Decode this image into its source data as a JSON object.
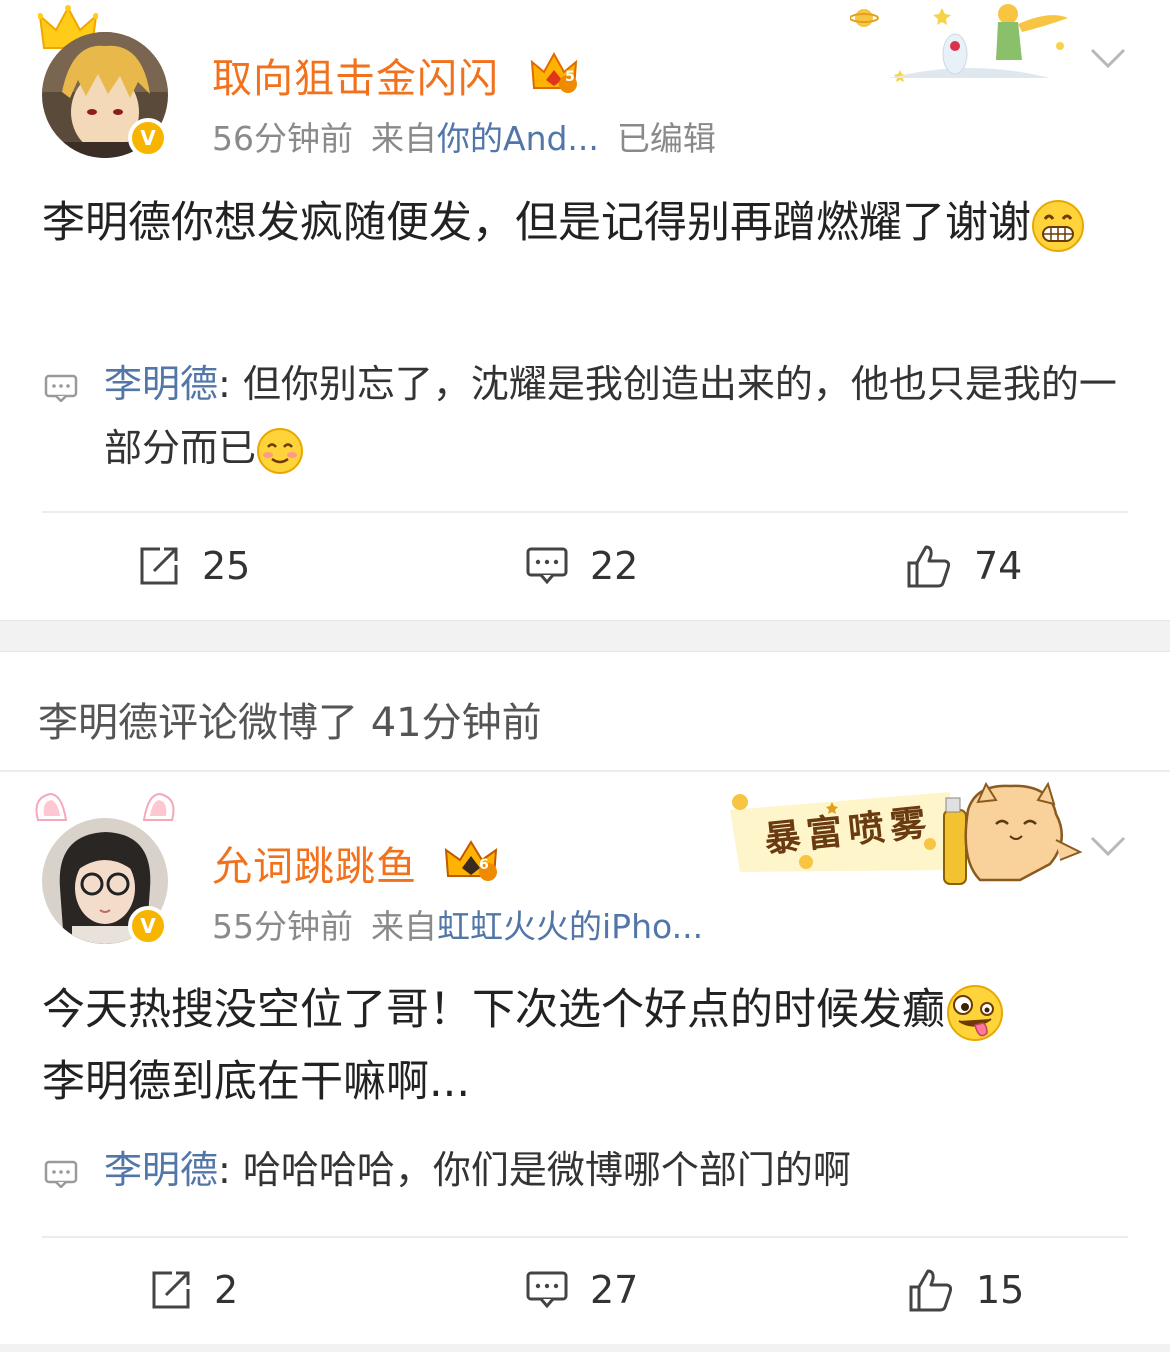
{
  "post1": {
    "username": "取向狙击金闪闪",
    "level": "5",
    "verified_label": "V",
    "time": "56分钟前",
    "from_label": "来自",
    "source": "你的And...",
    "edited": "已编辑",
    "content": "李明德你想发疯随便发，但是记得别再蹭燃耀了谢谢",
    "content_emoji": "grin-emoji",
    "reply_user": "李明德",
    "reply_sep": ":",
    "reply_text": " 但你别忘了，沈耀是我创造出来的，他也只是我的一部分而已",
    "reply_emoji": "smile-emoji",
    "reposts": "25",
    "comments": "22",
    "likes": "74"
  },
  "notice": {
    "text": "李明德评论微博了 41分钟前"
  },
  "post2": {
    "username": "允词跳跳鱼",
    "level": "6",
    "verified_label": "V",
    "time": "55分钟前",
    "from_label": "来自",
    "source": "虹虹火火的iPho...",
    "content_line1": "今天热搜没空位了哥！下次选个好点的时候发癫",
    "content_line2": "李明德到底在干嘛啊...",
    "content_emoji": "crazy-face-emoji",
    "reply_user": "李明德",
    "reply_sep": ":",
    "reply_text": " 哈哈哈哈，你们是微博哪个部门的啊",
    "reposts": "2",
    "comments": "27",
    "likes": "15",
    "banner_text": "暴富喷雾"
  },
  "colors": {
    "username": "#f2711c",
    "link": "#5276a8",
    "meta": "#8a8a8a",
    "verified": "#f7b500"
  }
}
